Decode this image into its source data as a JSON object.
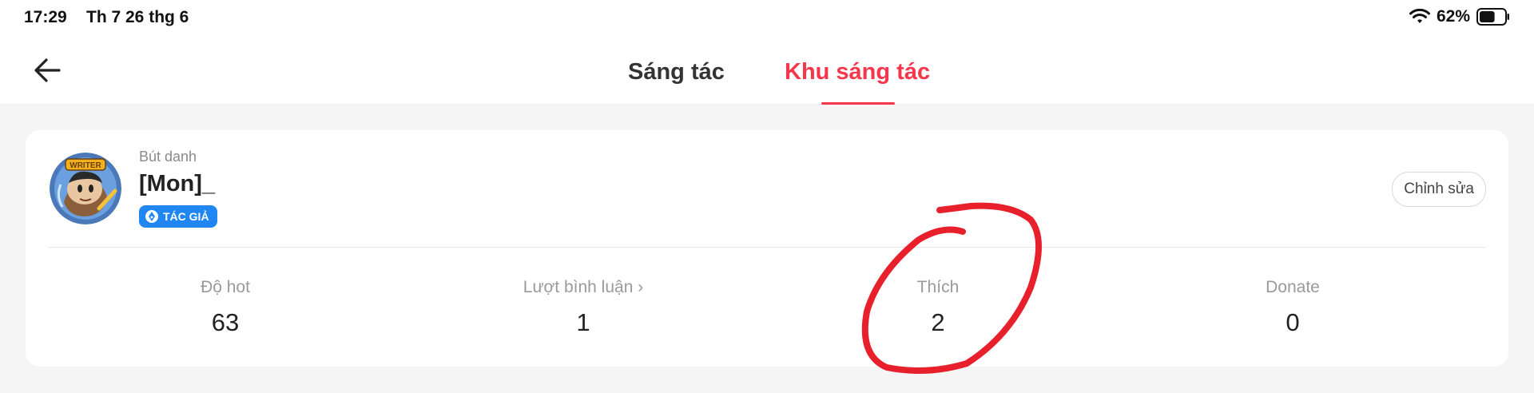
{
  "status_bar": {
    "time": "17:29",
    "date": "Th 7 26 thg 6",
    "battery_percent": "62%",
    "battery_level": 0.62
  },
  "nav": {
    "back_icon": "arrow-left-icon",
    "tabs": [
      {
        "label": "Sáng tác",
        "active": false
      },
      {
        "label": "Khu sáng tác",
        "active": true
      }
    ],
    "accent_color": "#f5364b"
  },
  "profile": {
    "pen_name_label": "Bút danh",
    "pen_name": "[Mon]_",
    "badge_label": "TÁC GIẢ",
    "avatar_badge_text": "WRITER",
    "edit_label": "Chỉnh sửa"
  },
  "stats": [
    {
      "label": "Độ hot",
      "value": "63"
    },
    {
      "label": "Lượt bình luận",
      "value": "1",
      "chevron": "›"
    },
    {
      "label": "Thích",
      "value": "2"
    },
    {
      "label": "Donate",
      "value": "0"
    }
  ],
  "annotation": {
    "color": "#e8202c",
    "shape": "hand-drawn circle around likes value"
  }
}
